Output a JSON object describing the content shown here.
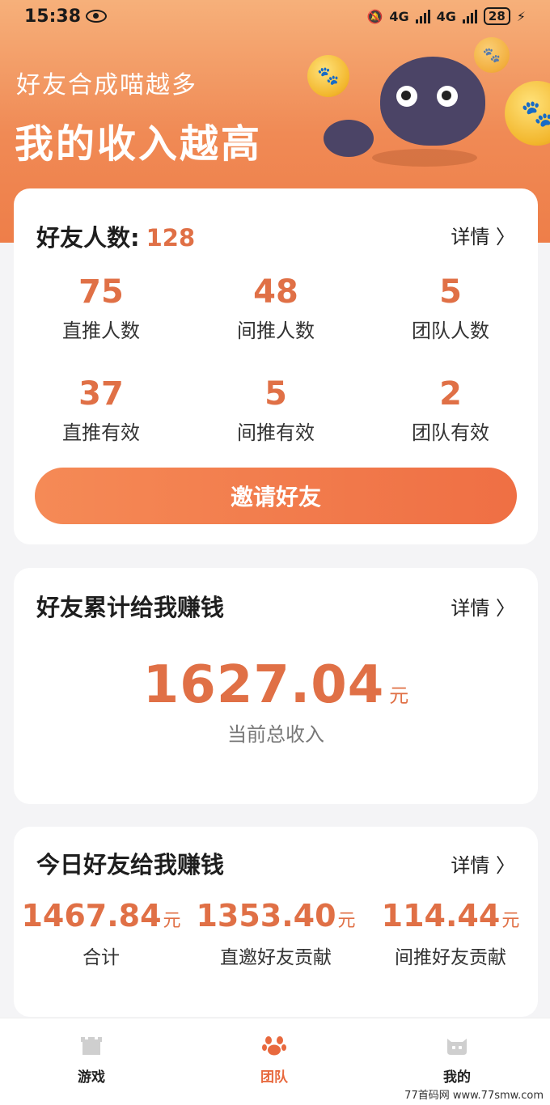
{
  "status_bar": {
    "time": "15:38",
    "network_1": "4G",
    "network_2": "4G",
    "battery": "28"
  },
  "hero": {
    "line1": "好友合成喵越多",
    "line2": "我的收入越高"
  },
  "friends_card": {
    "title": "好友人数:",
    "count": "128",
    "detail_link": "详情 〉",
    "stats": [
      {
        "value": "75",
        "label": "直推人数"
      },
      {
        "value": "48",
        "label": "间推人数"
      },
      {
        "value": "5",
        "label": "团队人数"
      },
      {
        "value": "37",
        "label": "直推有效"
      },
      {
        "value": "5",
        "label": "间推有效"
      },
      {
        "value": "2",
        "label": "团队有效"
      }
    ],
    "invite_button": "邀请好友"
  },
  "cumulative_card": {
    "title": "好友累计给我赚钱",
    "detail_link": "详情 〉",
    "amount": "1627.04",
    "unit": "元",
    "label": "当前总收入"
  },
  "today_card": {
    "title": "今日好友给我赚钱",
    "detail_link": "详情 〉",
    "items": [
      {
        "amount": "1467.84",
        "unit": "元",
        "label": "合计"
      },
      {
        "amount": "1353.40",
        "unit": "元",
        "label": "直邀好友贡献"
      },
      {
        "amount": "114.44",
        "unit": "元",
        "label": "间推好友贡献"
      }
    ]
  },
  "tab_bar": {
    "tabs": [
      {
        "label": "游戏",
        "icon": "castle-icon",
        "active": false
      },
      {
        "label": "团队",
        "icon": "paw-icon",
        "active": true
      },
      {
        "label": "我的",
        "icon": "cat-face-icon",
        "active": false
      }
    ]
  },
  "watermark": "77首码网 www.77smw.com",
  "colors": {
    "accent": "#e07046",
    "button": "#f07a4c",
    "hero_top": "#f6b07a",
    "hero_bottom": "#ee7e49"
  }
}
